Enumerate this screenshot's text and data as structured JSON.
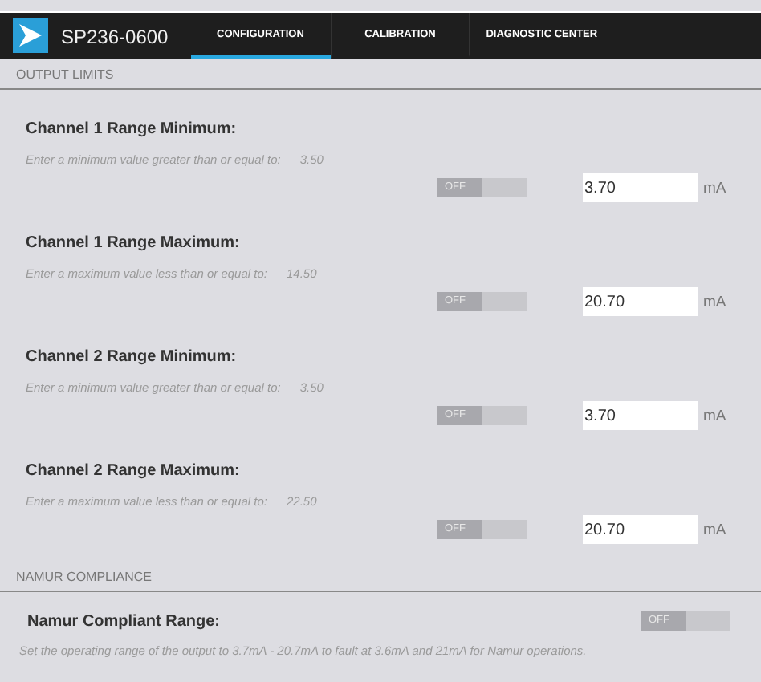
{
  "app": {
    "title": "SP236-0600"
  },
  "tabs": [
    {
      "label": "CONFIGURATION",
      "selected": true
    },
    {
      "label": "CALIBRATION",
      "selected": false
    },
    {
      "label": "DIAGNOSTIC CENTER",
      "selected": false
    }
  ],
  "output_limits": {
    "heading": "OUTPUT LIMITS",
    "fields": [
      {
        "title": "Channel 1 Range Minimum:",
        "hint": "Enter a minimum value greater than or equal to:",
        "limit": "3.50",
        "toggle": {
          "label": "OFF",
          "on": false
        },
        "value": "3.70",
        "unit": "mA"
      },
      {
        "title": "Channel 1 Range Maximum:",
        "hint": "Enter a maximum value less than or equal to:",
        "limit": "14.50",
        "toggle": {
          "label": "OFF",
          "on": false
        },
        "value": "20.70",
        "unit": "mA"
      },
      {
        "title": "Channel 2 Range Minimum:",
        "hint": "Enter a minimum value greater than or equal to:",
        "limit": "3.50",
        "toggle": {
          "label": "OFF",
          "on": false
        },
        "value": "3.70",
        "unit": "mA"
      },
      {
        "title": "Channel 2 Range Maximum:",
        "hint": "Enter a maximum value less than or equal to:",
        "limit": "22.50",
        "toggle": {
          "label": "OFF",
          "on": false
        },
        "value": "20.70",
        "unit": "mA"
      }
    ]
  },
  "namur": {
    "heading": "NAMUR COMPLIANCE",
    "title": "Namur Compliant Range:",
    "toggle": {
      "label": "OFF",
      "on": false
    },
    "description": "Set the operating range of the output to 3.7mA - 20.7mA to fault at 3.6mA and 21mA for Namur operations."
  }
}
